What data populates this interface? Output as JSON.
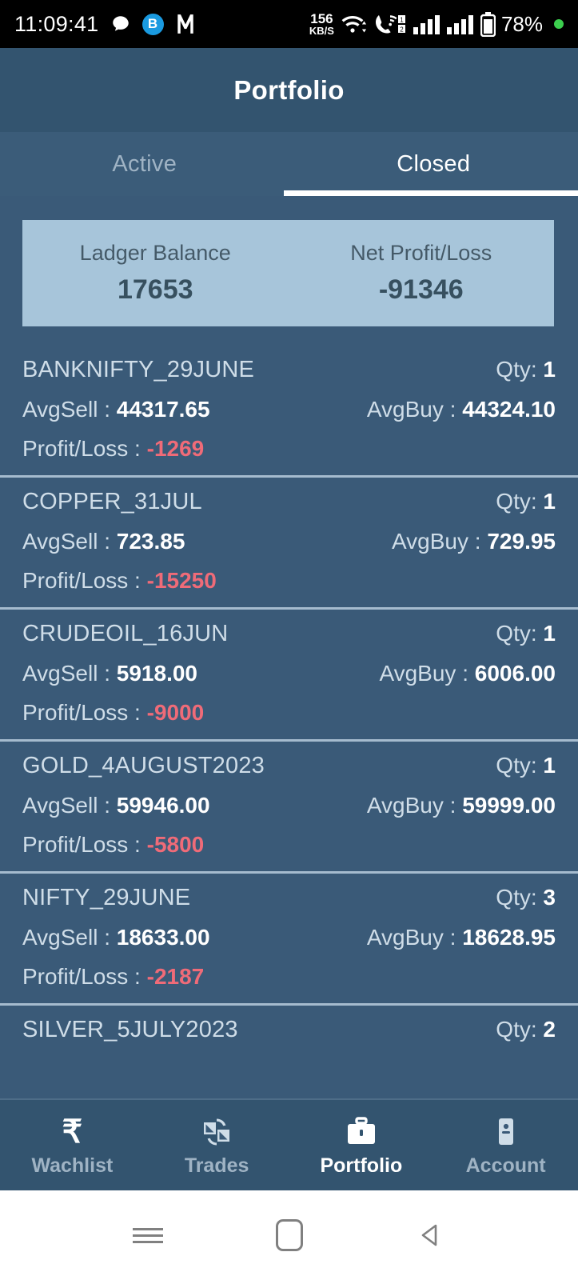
{
  "status_bar": {
    "time": "11:09:41",
    "network_speed_value": "156",
    "network_speed_unit": "KB/S",
    "battery_percent": "78%",
    "icons": [
      "chat-bubble-icon",
      "blue-b-badge-icon",
      "m-app-icon",
      "wifi-icon",
      "vowifi-call-icon",
      "sim1-signal-icon",
      "sim2-signal-icon",
      "battery-icon",
      "green-status-dot"
    ]
  },
  "header": {
    "title": "Portfolio"
  },
  "tabs": {
    "items": [
      {
        "label": "Active",
        "active": false
      },
      {
        "label": "Closed",
        "active": true
      }
    ]
  },
  "summary": {
    "ledger": {
      "label": "Ladger Balance",
      "value": "17653"
    },
    "net_pl": {
      "label": "Net Profit/Loss",
      "value": "-91346"
    }
  },
  "labels": {
    "qty": "Qty:",
    "avg_sell": "AvgSell :",
    "avg_buy": "AvgBuy :",
    "profit_loss": "Profit/Loss :"
  },
  "positions": [
    {
      "symbol": "BANKNIFTY_29JUNE",
      "qty": "1",
      "avg_sell": "44317.65",
      "avg_buy": "44324.10",
      "profit_loss": "-1269"
    },
    {
      "symbol": "COPPER_31JUL",
      "qty": "1",
      "avg_sell": "723.85",
      "avg_buy": "729.95",
      "profit_loss": "-15250"
    },
    {
      "symbol": "CRUDEOIL_16JUN",
      "qty": "1",
      "avg_sell": "5918.00",
      "avg_buy": "6006.00",
      "profit_loss": "-9000"
    },
    {
      "symbol": "GOLD_4AUGUST2023",
      "qty": "1",
      "avg_sell": "59946.00",
      "avg_buy": "59999.00",
      "profit_loss": "-5800"
    },
    {
      "symbol": "NIFTY_29JUNE",
      "qty": "3",
      "avg_sell": "18633.00",
      "avg_buy": "18628.95",
      "profit_loss": "-2187"
    },
    {
      "symbol": "SILVER_5JULY2023",
      "qty": "2",
      "avg_sell": "",
      "avg_buy": "",
      "profit_loss": ""
    }
  ],
  "bottom_nav": {
    "items": [
      {
        "label": "Wachlist",
        "icon": "rupee-icon",
        "active": false
      },
      {
        "label": "Trades",
        "icon": "exchange-documents-icon",
        "active": false
      },
      {
        "label": "Portfolio",
        "icon": "briefcase-icon",
        "active": true
      },
      {
        "label": "Account",
        "icon": "id-card-icon",
        "active": false
      }
    ]
  },
  "android_nav": {
    "recents": "recents-icon",
    "home": "home-icon",
    "back": "back-icon"
  },
  "colors": {
    "header_bg": "#33546f",
    "page_bg": "#3a5a78",
    "card_bg": "#a7c5da",
    "loss_text": "#ef6b78",
    "accent": "#ffffff"
  }
}
